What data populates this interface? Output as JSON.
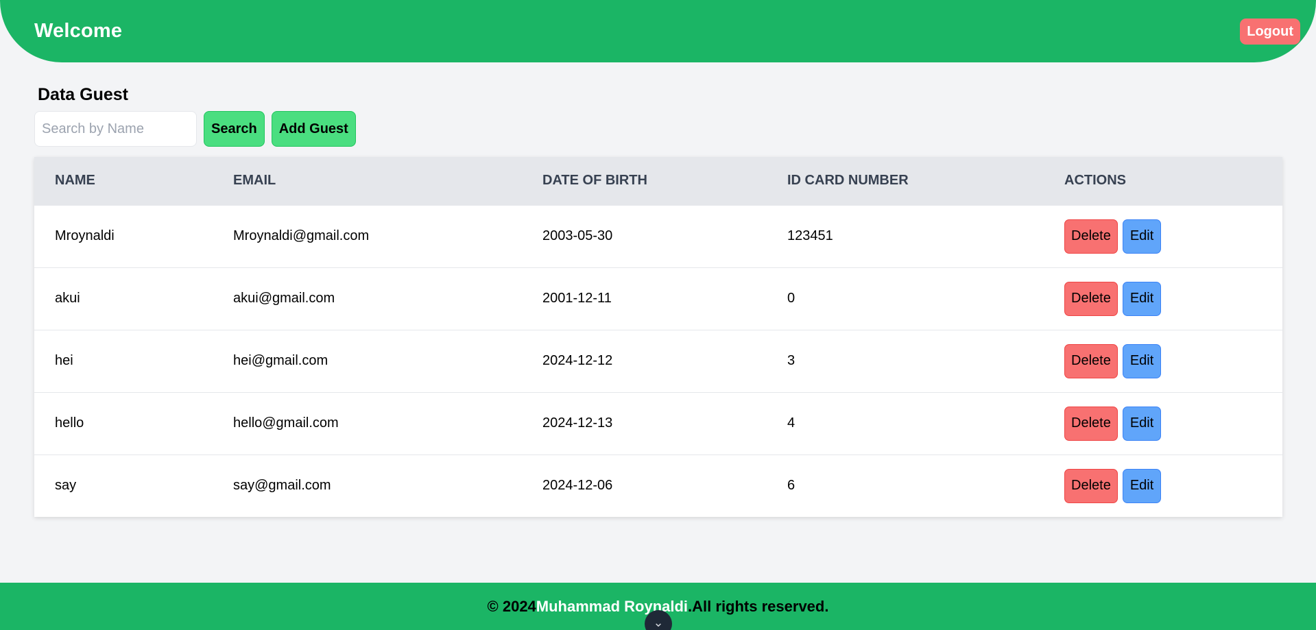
{
  "header": {
    "title": "Welcome",
    "logout_label": "Logout"
  },
  "section": {
    "title": "Data Guest"
  },
  "search": {
    "placeholder": "Search by Name",
    "value": "",
    "button_label": "Search"
  },
  "add_guest_label": "Add Guest",
  "table": {
    "headers": [
      "Name",
      "Email",
      "Date of Birth",
      "ID Card Number",
      "Actions"
    ],
    "rows": [
      {
        "name": "Mroynaldi",
        "email": "Mroynaldi@gmail.com",
        "dob": "2003-05-30",
        "id_card": "123451"
      },
      {
        "name": "akui",
        "email": "akui@gmail.com",
        "dob": "2001-12-11",
        "id_card": "0"
      },
      {
        "name": "hei",
        "email": "hei@gmail.com",
        "dob": "2024-12-12",
        "id_card": "3"
      },
      {
        "name": "hello",
        "email": "hello@gmail.com",
        "dob": "2024-12-13",
        "id_card": "4"
      },
      {
        "name": "say",
        "email": "say@gmail.com",
        "dob": "2024-12-06",
        "id_card": "6"
      }
    ],
    "delete_label": "Delete",
    "edit_label": "Edit"
  },
  "footer": {
    "prefix": "© 2024 ",
    "owner": "Muhammad Roynaldi",
    "suffix": ".All rights reserved."
  },
  "scroll_icon": "chevron-down-icon",
  "colors": {
    "primary_green": "#1bb565",
    "button_green": "#4ade80",
    "delete_red": "#f87171",
    "edit_blue": "#60a5fa",
    "background": "#f3f4f6"
  }
}
